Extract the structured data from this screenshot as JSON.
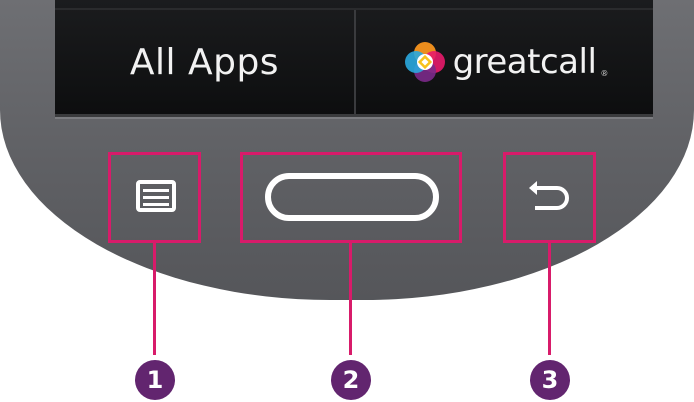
{
  "screen": {
    "left_label": "All Apps",
    "brand_name": "greatcall",
    "brand_mark": "®"
  },
  "keys": [
    {
      "name": "menu",
      "icon": "menu-icon"
    },
    {
      "name": "home",
      "icon": "home-icon"
    },
    {
      "name": "back",
      "icon": "back-arrow-icon"
    }
  ],
  "callouts": [
    "1",
    "2",
    "3"
  ],
  "colors": {
    "highlight": "#d81b6a",
    "badge": "#62256f",
    "body": "#616266",
    "screen": "#141516"
  }
}
